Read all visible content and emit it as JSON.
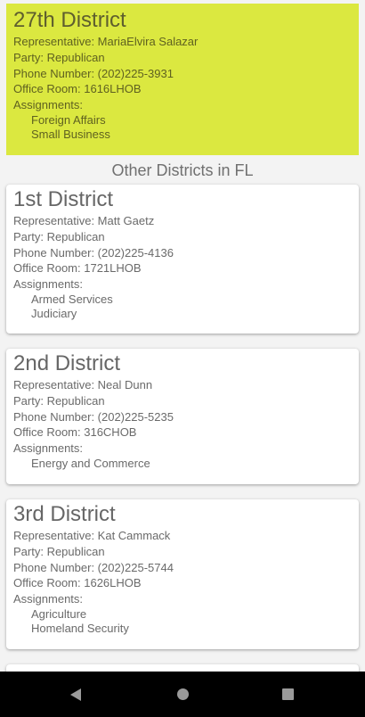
{
  "featured": {
    "title": "27th District",
    "representative": "Representative: MariaElvira Salazar",
    "party": "Party: Republican",
    "phone": "Phone Number: (202)225-3931",
    "office": "Office Room: 1616LHOB",
    "assignments_label": "Assignments:",
    "assignments": [
      "Foreign Affairs",
      "Small Business"
    ]
  },
  "section_header": "Other Districts in FL",
  "districts": [
    {
      "title": "1st District",
      "representative": "Representative: Matt Gaetz",
      "party": "Party: Republican",
      "phone": "Phone Number: (202)225-4136",
      "office": "Office Room: 1721LHOB",
      "assignments_label": "Assignments:",
      "assignments": [
        "Armed Services",
        "Judiciary"
      ]
    },
    {
      "title": "2nd District",
      "representative": "Representative: Neal Dunn",
      "party": "Party: Republican",
      "phone": "Phone Number: (202)225-5235",
      "office": "Office Room: 316CHOB",
      "assignments_label": "Assignments:",
      "assignments": [
        "Energy and Commerce"
      ]
    },
    {
      "title": "3rd District",
      "representative": "Representative: Kat Cammack",
      "party": "Party: Republican",
      "phone": "Phone Number: (202)225-5744",
      "office": "Office Room: 1626LHOB",
      "assignments_label": "Assignments:",
      "assignments": [
        "Agriculture",
        "Homeland Security"
      ]
    }
  ],
  "navbar": {
    "back_icon": "back-triangle-icon",
    "home_icon": "home-circle-icon",
    "recents_icon": "recents-square-icon"
  },
  "colors": {
    "featured_bg": "#dbe840",
    "card_bg": "#ffffff",
    "navbar_bg": "#000000"
  }
}
